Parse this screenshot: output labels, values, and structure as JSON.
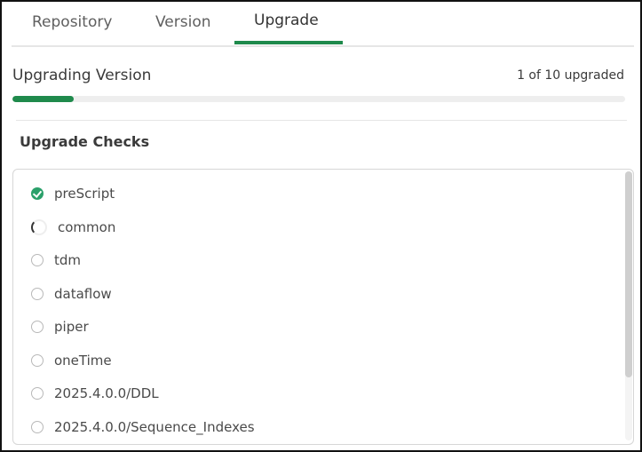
{
  "tabs": [
    {
      "label": "Repository"
    },
    {
      "label": "Version"
    },
    {
      "label": "Upgrade",
      "active": true
    }
  ],
  "upgrade": {
    "title": "Upgrading Version",
    "progress_text": "1 of 10 upgraded",
    "completed": 1,
    "total": 10,
    "accent_color": "#1f8a4c"
  },
  "checks": {
    "title": "Upgrade Checks",
    "items": [
      {
        "label": "preScript",
        "status": "done"
      },
      {
        "label": "common",
        "status": "running"
      },
      {
        "label": "tdm",
        "status": "pending"
      },
      {
        "label": "dataflow",
        "status": "pending"
      },
      {
        "label": "piper",
        "status": "pending"
      },
      {
        "label": "oneTime",
        "status": "pending"
      },
      {
        "label": "2025.4.0.0/DDL",
        "status": "pending"
      },
      {
        "label": "2025.4.0.0/Sequence_Indexes",
        "status": "pending"
      }
    ]
  },
  "icons": {
    "done": "check-circle-icon",
    "running": "spinner-icon",
    "pending": "empty-circle-icon"
  }
}
